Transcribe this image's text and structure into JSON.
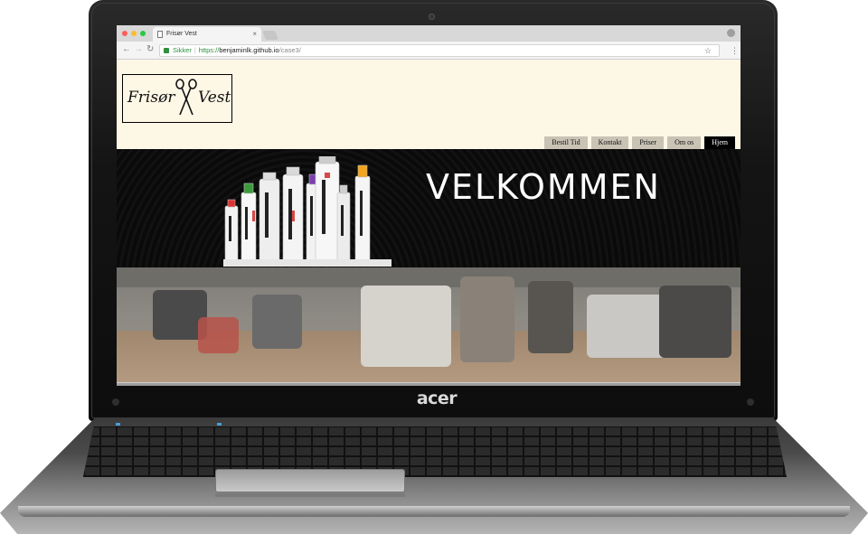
{
  "device": {
    "brand": "acer"
  },
  "browser": {
    "tab": {
      "title": "Frisør Vest"
    },
    "address": {
      "secure_label": "Sikker",
      "url_scheme": "https://",
      "url_host": "benjaminlk.github.io",
      "url_path": "/case3/"
    }
  },
  "site": {
    "logo": {
      "left": "Frisør",
      "right": "Vest"
    },
    "nav": [
      {
        "label": "Bestil Tid",
        "active": false
      },
      {
        "label": "Kontakt",
        "active": false
      },
      {
        "label": "Priser",
        "active": false
      },
      {
        "label": "Om os",
        "active": false
      },
      {
        "label": "Hjem",
        "active": true
      }
    ],
    "hero": {
      "title": "VELKOMMEN"
    }
  },
  "colors": {
    "page_background": "#fdf7e6",
    "nav_item": "#c9c3b5",
    "nav_active": "#000000",
    "hero_background": "#0a0a0a",
    "secure_green": "#2e8f3e"
  }
}
